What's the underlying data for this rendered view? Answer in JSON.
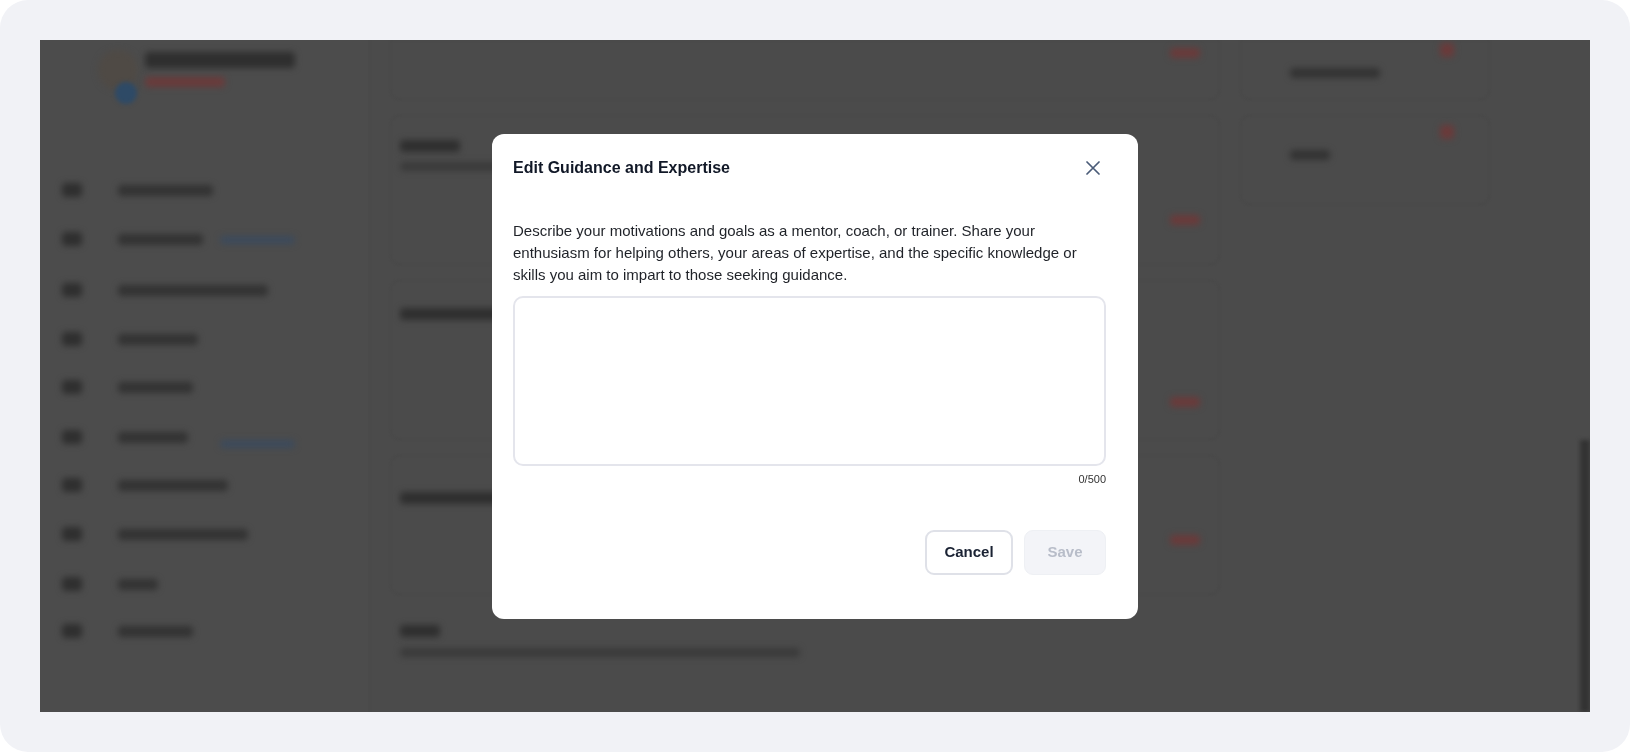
{
  "dialog": {
    "title": "Edit Guidance and Expertise",
    "description": "Describe your motivations and goals as a mentor, coach, or trainer. Share your enthusiasm for helping others, your areas of expertise, and the specific knowledge or skills you aim to impart to those seeking guidance.",
    "counter": "0/500",
    "buttons": [
      {
        "label": "Cancel",
        "disabled": false
      },
      {
        "label": "Save",
        "disabled": true
      }
    ]
  }
}
